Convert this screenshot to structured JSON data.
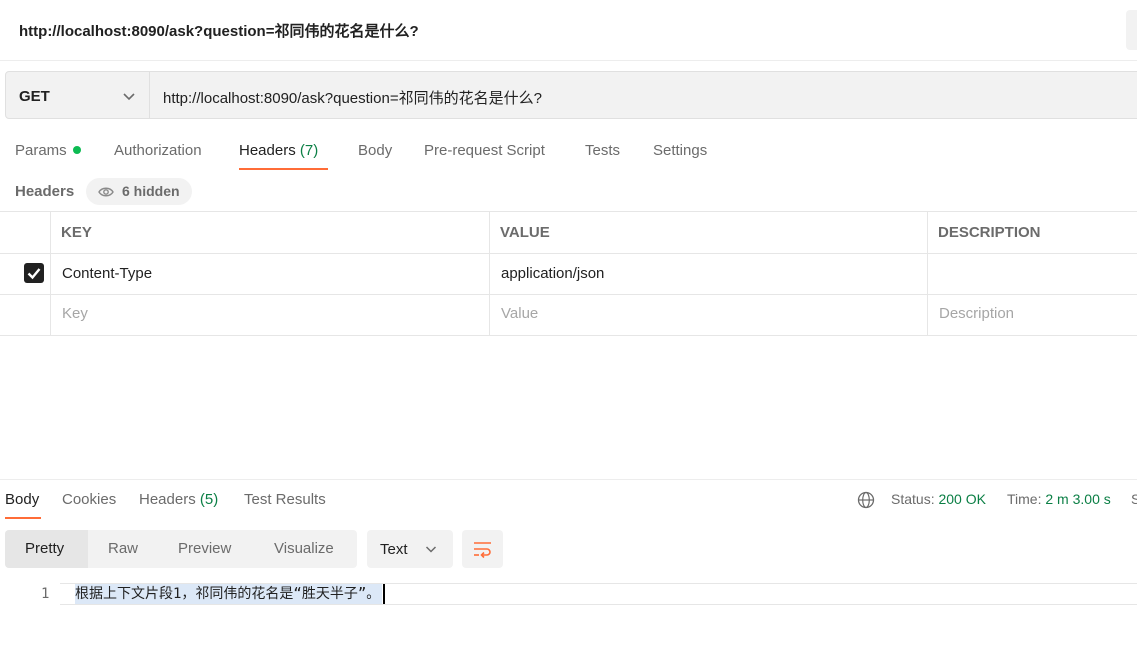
{
  "request": {
    "title": "http://localhost:8090/ask?question=祁同伟的花名是什么?",
    "method": "GET",
    "url": "http://localhost:8090/ask?question=祁同伟的花名是什么?"
  },
  "request_tabs": {
    "params": "Params",
    "authorization": "Authorization",
    "headers": "Headers",
    "headers_count": "(7)",
    "body": "Body",
    "pre_request": "Pre-request Script",
    "tests": "Tests",
    "settings": "Settings"
  },
  "headers_section": {
    "label": "Headers",
    "hidden": "6 hidden",
    "columns": {
      "key": "KEY",
      "value": "VALUE",
      "description": "DESCRIPTION"
    },
    "rows": [
      {
        "key": "Content-Type",
        "value": "application/json",
        "description": "",
        "checked": true
      }
    ],
    "placeholders": {
      "key": "Key",
      "value": "Value",
      "description": "Description"
    }
  },
  "response_tabs": {
    "body": "Body",
    "cookies": "Cookies",
    "headers": "Headers",
    "headers_count": "(5)",
    "test_results": "Test Results"
  },
  "response_status": {
    "status_label": "Status:",
    "status_value": "200 OK",
    "time_label": "Time:",
    "time_value": "2 m 3.00 s",
    "size_label": "S"
  },
  "format_bar": {
    "pretty": "Pretty",
    "raw": "Raw",
    "preview": "Preview",
    "visualize": "Visualize",
    "format": "Text"
  },
  "response_body": {
    "line_number": "1",
    "line_text": "根据上下文片段1，祁同伟的花名是“胜天半子”。"
  },
  "colors": {
    "accent": "#ff6c37",
    "success": "#0b7f45",
    "dot": "#0cbb52"
  }
}
